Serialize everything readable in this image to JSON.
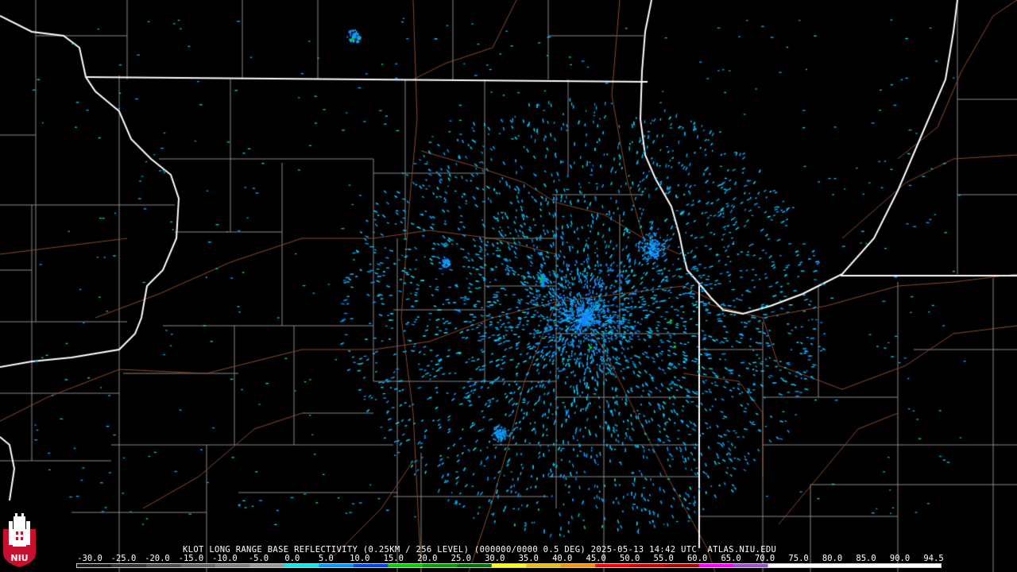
{
  "caption": "KLOT LONG RANGE BASE REFLECTIVITY (0.25KM / 256 LEVEL) (000000/0000 0.5 DEG) 2025-05-13 14:42 UTC  ATLAS.NIU.EDU",
  "scale": {
    "labels": [
      "-30.0",
      "-25.0",
      "-20.0",
      "-15.0",
      "-10.0",
      "-5.0",
      "0.0",
      "5.0",
      "10.0",
      "15.0",
      "20.0",
      "25.0",
      "30.0",
      "35.0",
      "40.0",
      "45.0",
      "50.0",
      "55.0",
      "60.0",
      "65.0",
      "70.0",
      "75.0",
      "80.0",
      "85.0",
      "90.0",
      "94.5"
    ],
    "colors": [
      "#1a1a1a",
      "#333333",
      "#4d4d4d",
      "#666666",
      "#808080",
      "#9a9a9a",
      "#00e8e8",
      "#0099ff",
      "#0044ee",
      "#00d000",
      "#00a000",
      "#007000",
      "#ffff00",
      "#e8c000",
      "#ff9000",
      "#ff0000",
      "#d00000",
      "#b00000",
      "#ff00ff",
      "#9955cc",
      "#ffffff",
      "#ffffff",
      "#ffffff",
      "#ffffff",
      "#ffffff"
    ]
  },
  "logo": {
    "text": "NIU",
    "colors": {
      "shield": "#c8102e",
      "tower": "#ffffff"
    }
  },
  "map": {
    "background": "#000000",
    "state_border_color": "#ffffff",
    "county_line_color": "#8a8a8a",
    "road_color": "#8b4a2b",
    "echo_colors": [
      "#00b4ff",
      "#00d8e8",
      "#0099ff",
      "#1e7fff",
      "#00d000"
    ]
  }
}
